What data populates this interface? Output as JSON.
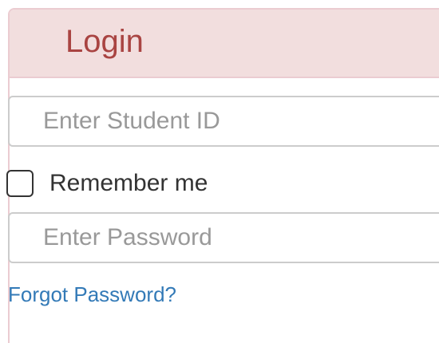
{
  "login": {
    "title": "Login",
    "student_id": {
      "placeholder": "Enter Student ID",
      "value": ""
    },
    "remember_me": {
      "label": "Remember me",
      "checked": false
    },
    "password": {
      "placeholder": "Enter Password",
      "value": ""
    },
    "forgot_password_label": "Forgot Password?"
  },
  "colors": {
    "heading_background": "#f2dede",
    "heading_border": "#ebccd1",
    "title_text": "#a94442",
    "link": "#337ab7",
    "input_border": "#cccccc",
    "placeholder": "#999999"
  },
  "icons": {
    "checkbox": "checkbox-unchecked-icon"
  }
}
